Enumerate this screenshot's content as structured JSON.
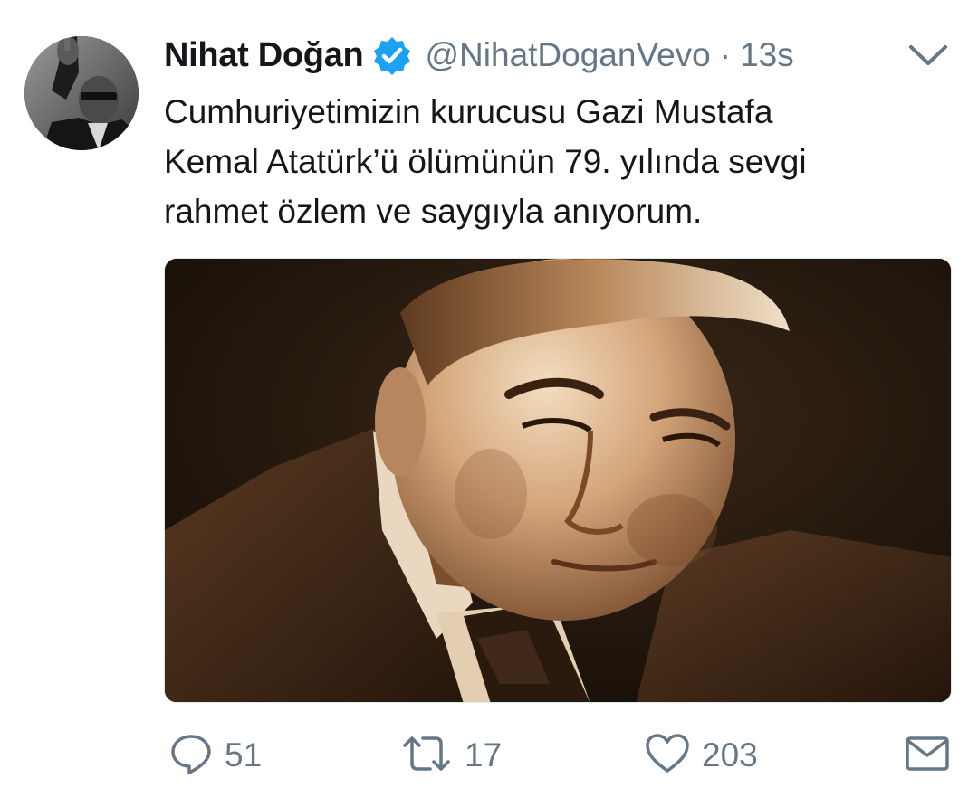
{
  "tweet": {
    "author": {
      "display_name": "Nihat Doğan",
      "handle": "@NihatDoganVevo",
      "verified": true,
      "verified_color": "#1da1f2"
    },
    "separator": "·",
    "time": "13s",
    "text": "Cumhuriyetimizin kurucusu Gazi Mustafa\nKemal Atatürk’ü ölümünün 79. yılında sevgi\nrahmet özlem ve saygıyla anıyorum.",
    "media": {
      "kind": "sepia-portrait-painting"
    },
    "actions": {
      "reply_count": "51",
      "retweet_count": "17",
      "like_count": "203"
    },
    "icons": {
      "avatar": "avatar-photo",
      "verified": "verified-badge-icon",
      "caret": "chevron-down-icon",
      "reply": "reply-icon",
      "retweet": "retweet-icon",
      "like": "heart-icon",
      "dm": "envelope-icon"
    },
    "colors": {
      "text": "#14171a",
      "secondary": "#657786",
      "border": "#e1e8ed"
    }
  }
}
